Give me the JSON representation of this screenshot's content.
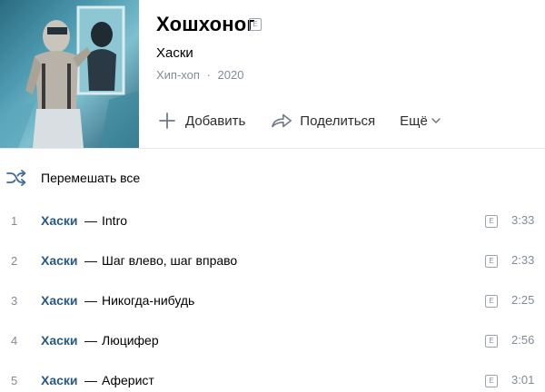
{
  "album": {
    "title": "Хошхоног",
    "explicit_mark": "E",
    "artist": "Хаски",
    "genre": "Хип-хоп",
    "separator": "·",
    "year": "2020"
  },
  "actions": {
    "add_label": "Добавить",
    "share_label": "Поделиться",
    "more_label": "Ещё"
  },
  "shuffle_label": "Перемешать все",
  "tracks": [
    {
      "num": "1",
      "artist": "Хаски",
      "dash": "—",
      "title": "Intro",
      "explicit": "E",
      "duration": "3:33"
    },
    {
      "num": "2",
      "artist": "Хаски",
      "dash": "—",
      "title": "Шаг влево, шаг вправо",
      "explicit": "E",
      "duration": "2:33"
    },
    {
      "num": "3",
      "artist": "Хаски",
      "dash": "—",
      "title": "Никогда-нибудь",
      "explicit": "E",
      "duration": "2:25"
    },
    {
      "num": "4",
      "artist": "Хаски",
      "dash": "—",
      "title": "Люцифер",
      "explicit": "E",
      "duration": "2:56"
    },
    {
      "num": "5",
      "artist": "Хаски",
      "dash": "—",
      "title": "Аферист",
      "explicit": "E",
      "duration": "3:01"
    }
  ],
  "colors": {
    "link_blue": "#2a5885",
    "secondary_gray": "#818c99",
    "icon_blue": "#3f6a9a"
  },
  "icons": {
    "add": "plus-icon",
    "share": "share-arrow-icon",
    "more": "chevron-down-icon",
    "shuffle": "shuffle-icon"
  }
}
